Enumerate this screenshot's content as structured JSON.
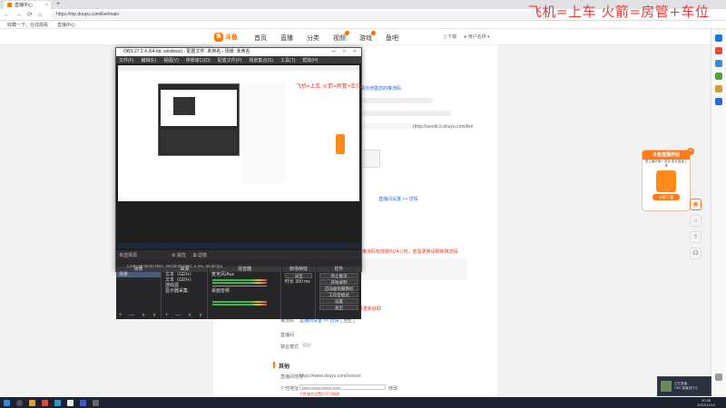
{
  "browser": {
    "tab_title": "直播中心",
    "tab_close": "×",
    "new_tab": "+",
    "url": "https://mp.douyu.com/live/main",
    "nav": {
      "back": "←",
      "forward": "→",
      "reload": "⟳",
      "home": "⌂"
    },
    "bookmarks": [
      "收藏一下，在线观看",
      "直播中心"
    ]
  },
  "overlay_text": "飞机=上车 火箭=房管+车位",
  "site": {
    "logo_text": "斗鱼",
    "nav": [
      {
        "label": "首页",
        "dot": false
      },
      {
        "label": "直播",
        "dot": false
      },
      {
        "label": "分类",
        "dot": false
      },
      {
        "label": "视频",
        "dot": true
      },
      {
        "label": "游戏",
        "dot": true
      },
      {
        "label": "鱼吧",
        "dot": false
      }
    ],
    "user": {
      "phone": "下载",
      "name": "用户名称"
    }
  },
  "obs": {
    "title": "OBS 27.2.4 (64-bit, windows) - 配置文件: 未命名 - 场景: 未命名",
    "window_controls": [
      "—",
      "□",
      "×"
    ],
    "menu": [
      "文件(F)",
      "编辑(E)",
      "视图(V)",
      "停靠窗口(D)",
      "配置文件(P)",
      "场景集合(S)",
      "工具(T)",
      "帮助(H)"
    ],
    "preview_overlay_text": "飞机=上车 火箭=房管+车位",
    "status_row": {
      "scene_label": "未选择源",
      "properties": "属性",
      "filters": "滤镜"
    },
    "panels": {
      "scenes": {
        "title": "场景",
        "items": [
          "场景"
        ]
      },
      "sources": {
        "title": "来源",
        "items": [
          "文本（GDI+）",
          "文本（GDI+）",
          "游戏源",
          "显示器采集"
        ]
      },
      "mixer": {
        "title": "混音器",
        "tracks": [
          "麦克风/Aux",
          "桌面音频"
        ]
      },
      "transitions": {
        "title": "转场特效",
        "type": "淡出",
        "duration_label": "时长",
        "duration_value": "300 ms"
      },
      "controls": {
        "title": "控件",
        "buttons": [
          "停止推流",
          "开始录制",
          "启动虚拟摄像机",
          "工作室模式",
          "设置",
          "退出"
        ]
      }
    },
    "footer_icons": "+ — ∧ ∨",
    "bottom_status": "LIVE: 00:00:00    REC: 00:00:00    CPU: 2.4%, 60.00 fps"
  },
  "page": {
    "stream_notice": "请勿泄露您的推流码",
    "rtmp_note": "rtmp://sendtc3.douyu.com/live",
    "copy_button": "复制",
    "warning1": "推流码有效期为24小时，若需更换请刷新推流码",
    "warning2": "推流地址和推流码每次直播前请重新获取",
    "field_labels": [
      "推流码",
      "直播间",
      "禁言模式"
    ],
    "link_text": "直播间设置 >> 详情",
    "section_other": "其他",
    "other_labels": [
      "直播间地址",
      "个性地址"
    ],
    "room_url": "https://www.douyu.com/xxxxxx",
    "custom_url_placeholder": "https://www.douyu.com/",
    "custom_url_button": "修改",
    "custom_note": "个性域名设置后不可修改"
  },
  "promo": {
    "title": "斗鱼直播伴侣",
    "subtitle": "是主播的第一选择\n更多直播工具",
    "button": "立即下载",
    "close": "×"
  },
  "taskbar": {
    "time": "20:38",
    "date": "2022/11/10"
  },
  "notification": {
    "title": "正在直播",
    "subtitle": "OBS  直播进行中"
  }
}
